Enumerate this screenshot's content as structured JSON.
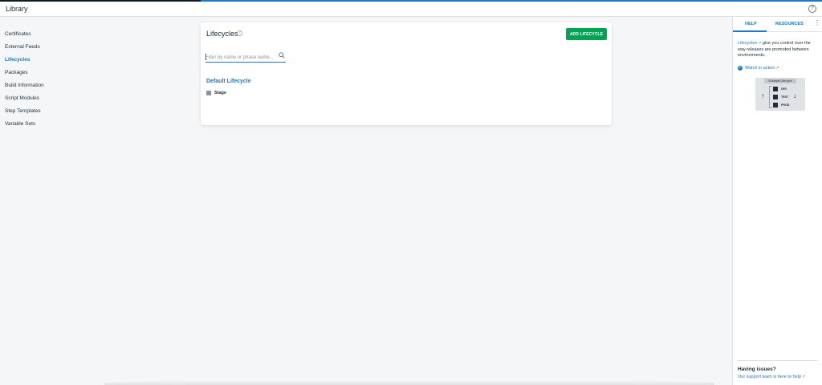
{
  "header": {
    "title": "Library",
    "help_icon": "question-circle-icon"
  },
  "sidebar": {
    "items": [
      {
        "label": "Certificates",
        "active": false
      },
      {
        "label": "External Feeds",
        "active": false
      },
      {
        "label": "Lifecycles",
        "active": true
      },
      {
        "label": "Packages",
        "active": false
      },
      {
        "label": "Build Information",
        "active": false
      },
      {
        "label": "Script Modules",
        "active": false
      },
      {
        "label": "Step Templates",
        "active": false
      },
      {
        "label": "Variable Sets",
        "active": false
      }
    ]
  },
  "main": {
    "title": "Lifecycles",
    "add_button_label": "ADD LIFECYCLE",
    "filter_placeholder": "Filter by name or phase name...",
    "lifecycles": [
      {
        "name": "Default Lifecycle",
        "phases": [
          {
            "name": "Stage"
          }
        ]
      }
    ]
  },
  "help_panel": {
    "tabs": [
      {
        "label": "HELP",
        "active": true
      },
      {
        "label": "RESOURCES",
        "active": false
      }
    ],
    "description_link": "Lifecycles",
    "description_text": " give you control over the way releases are promoted between environments.",
    "watch_label": "Watch in action",
    "diagram": {
      "title": "Example Lifecycle",
      "environments": [
        "DEV",
        "TEST",
        "PROD"
      ]
    },
    "issues_title": "Having issues?",
    "issues_link": "Our support team is here to help"
  },
  "colors": {
    "accent": "#1a77ca",
    "primary_button": "#00a352",
    "background": "#f4f6f8"
  }
}
